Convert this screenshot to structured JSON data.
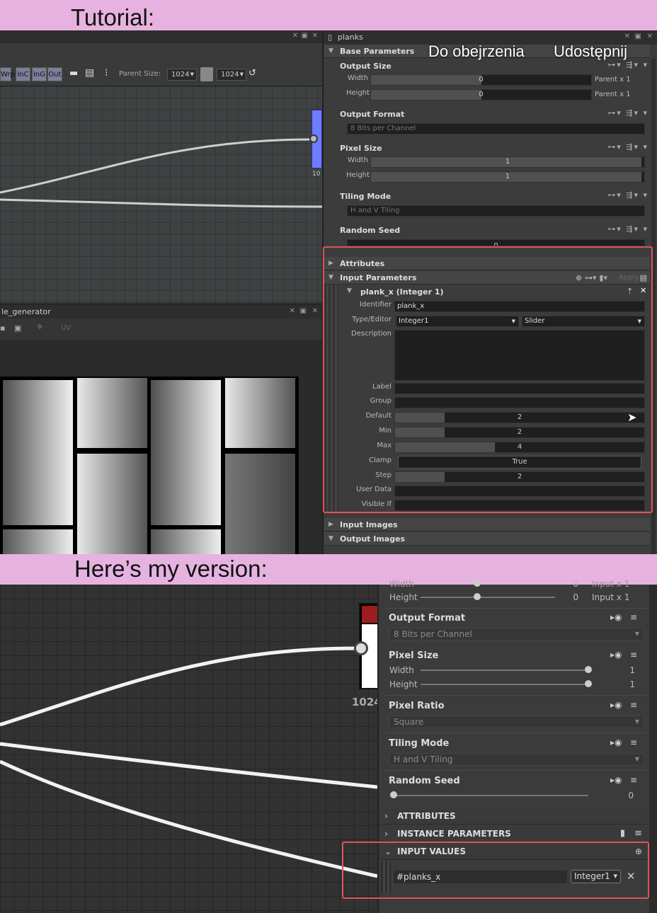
{
  "tutorial_label": "Tutorial:",
  "version_label": "Here’s my version:",
  "overlay": {
    "watch": "Do obejrzenia",
    "share": "Udostępnij"
  },
  "t1": {
    "toolbar": {
      "wrp": "Wrp",
      "inc": "InC",
      "ing": "InG",
      "out": "Out",
      "parent_size_label": "Parent Size:",
      "parent_size_val": "1024",
      "size_val2": "1024"
    },
    "node_size": "10",
    "tab2_name": "le_generator",
    "tab2_uv": "UV",
    "props_title": "planks",
    "base_params": "Base Parameters",
    "output_size": "Output Size",
    "width": "Width",
    "height": "Height",
    "os_w": "0",
    "os_h": "0",
    "parent_x1": "Parent x 1",
    "parent_x1b": "Parent x 1",
    "output_format": "Output Format",
    "of_val": "8 Bits per Channel",
    "pixel_size": "Pixel Size",
    "ps_w": "1",
    "ps_h": "1",
    "tiling_mode": "Tiling Mode",
    "tm_val": "H and V Tiling",
    "random_seed": "Random Seed",
    "rs_val": "0",
    "attributes": "Attributes",
    "input_params": "Input Parameters",
    "apply": "Apply",
    "param_name": "plank_x (Integer 1)",
    "f_identifier": "Identifier",
    "v_identifier": "plank_x",
    "f_type": "Type/Editor",
    "v_type": "Integer1",
    "v_editor": "Slider",
    "f_desc": "Description",
    "f_label": "Label",
    "f_group": "Group",
    "f_default": "Default",
    "v_default": "2",
    "f_min": "Min",
    "v_min": "2",
    "f_max": "Max",
    "v_max": "4",
    "f_clamp": "Clamp",
    "v_clamp": "True",
    "f_step": "Step",
    "v_step": "2",
    "f_userdata": "User Data",
    "f_visible": "Visible If",
    "input_images": "Input Images",
    "output_images": "Output Images"
  },
  "t2": {
    "width_top": "Width",
    "height": "Height",
    "h_val": "0",
    "input_x1": "Input x 1",
    "input_x1_top": "Input x 1",
    "w_top_val": "0",
    "output_format": "Output Format",
    "of_val": "8 Bits per Channel",
    "pixel_size": "Pixel Size",
    "width": "Width",
    "ps_w": "1",
    "ps_h": "1",
    "pixel_ratio": "Pixel Ratio",
    "pr_val": "Square",
    "tiling_mode": "Tiling Mode",
    "tm_val": "H and V Tiling",
    "random_seed": "Random Seed",
    "rs_val": "0",
    "attributes": "ATTRIBUTES",
    "instance_params": "INSTANCE PARAMETERS",
    "input_values": "INPUT VALUES",
    "param_id": "#planks_x",
    "param_type": "Integer1",
    "node_size": "1024"
  },
  "colors": {
    "band": "#e6b2e0",
    "highlight": "#e05555"
  }
}
